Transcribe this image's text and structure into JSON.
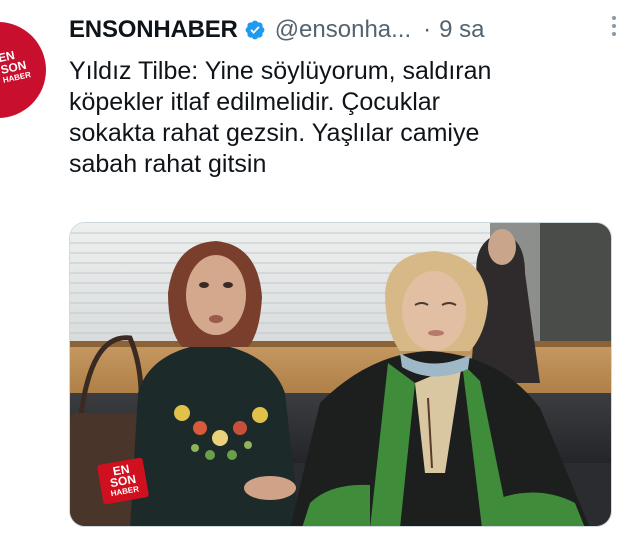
{
  "author": {
    "display_name": "ENSONHABER",
    "handle": "@ensonha...",
    "separator": "·",
    "time": "9 sa",
    "avatar_lines": [
      "EN",
      "SON",
      "HABER"
    ]
  },
  "tweet": {
    "text": "Yıldız Tilbe: Yine söylüyorum, saldıran\nköpekler itlaf edilmelidir. Çocuklar\nsokakta rahat gezsin. Yaşlılar camiye\nsabah rahat gitsin"
  },
  "media": {
    "watermark_lines": [
      "EN",
      "SON",
      "HABER"
    ]
  },
  "colors": {
    "brand_red": "#c8102e",
    "verified_blue": "#1d9bf0",
    "secondary_text": "#536471"
  },
  "icons": {
    "verified": "verified-badge-icon",
    "more": "more-vertical-icon"
  }
}
